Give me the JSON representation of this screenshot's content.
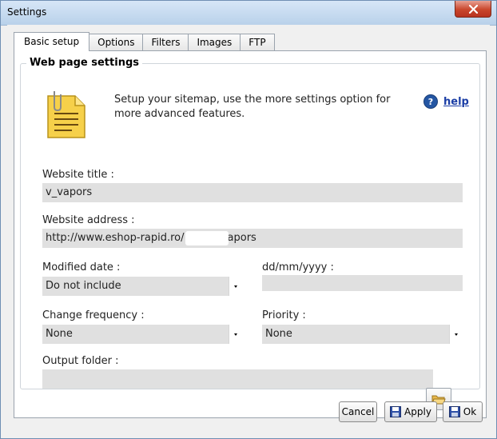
{
  "window": {
    "title": "Settings"
  },
  "tabs": [
    {
      "label": "Basic setup",
      "active": true
    },
    {
      "label": "Options"
    },
    {
      "label": "Filters"
    },
    {
      "label": "Images"
    },
    {
      "label": "FTP"
    }
  ],
  "section": {
    "legend": "Web page settings",
    "intro": "Setup your sitemap, use the more settings option for more advanced features.",
    "help_label": "help"
  },
  "fields": {
    "website_title": {
      "label": "Website title :",
      "value": "v_vapors"
    },
    "website_address": {
      "label": "Website address :",
      "value_prefix": "http://www.eshop-rapid.ro/",
      "value_suffix": "apors"
    },
    "modified_date": {
      "label": "Modified date :",
      "value": "Do not include"
    },
    "date_format": {
      "label": "dd/mm/yyyy :",
      "value": ""
    },
    "change_frequency": {
      "label": "Change frequency :",
      "value": "None"
    },
    "priority": {
      "label": "Priority :",
      "value": "None"
    },
    "output_folder": {
      "label": "Output folder :",
      "value": ""
    }
  },
  "buttons": {
    "cancel": "Cancel",
    "apply": "Apply",
    "ok": "Ok"
  },
  "colors": {
    "accent": "#1a3da5",
    "field_bg": "#e0e0e0",
    "close_red": "#c9462c"
  }
}
